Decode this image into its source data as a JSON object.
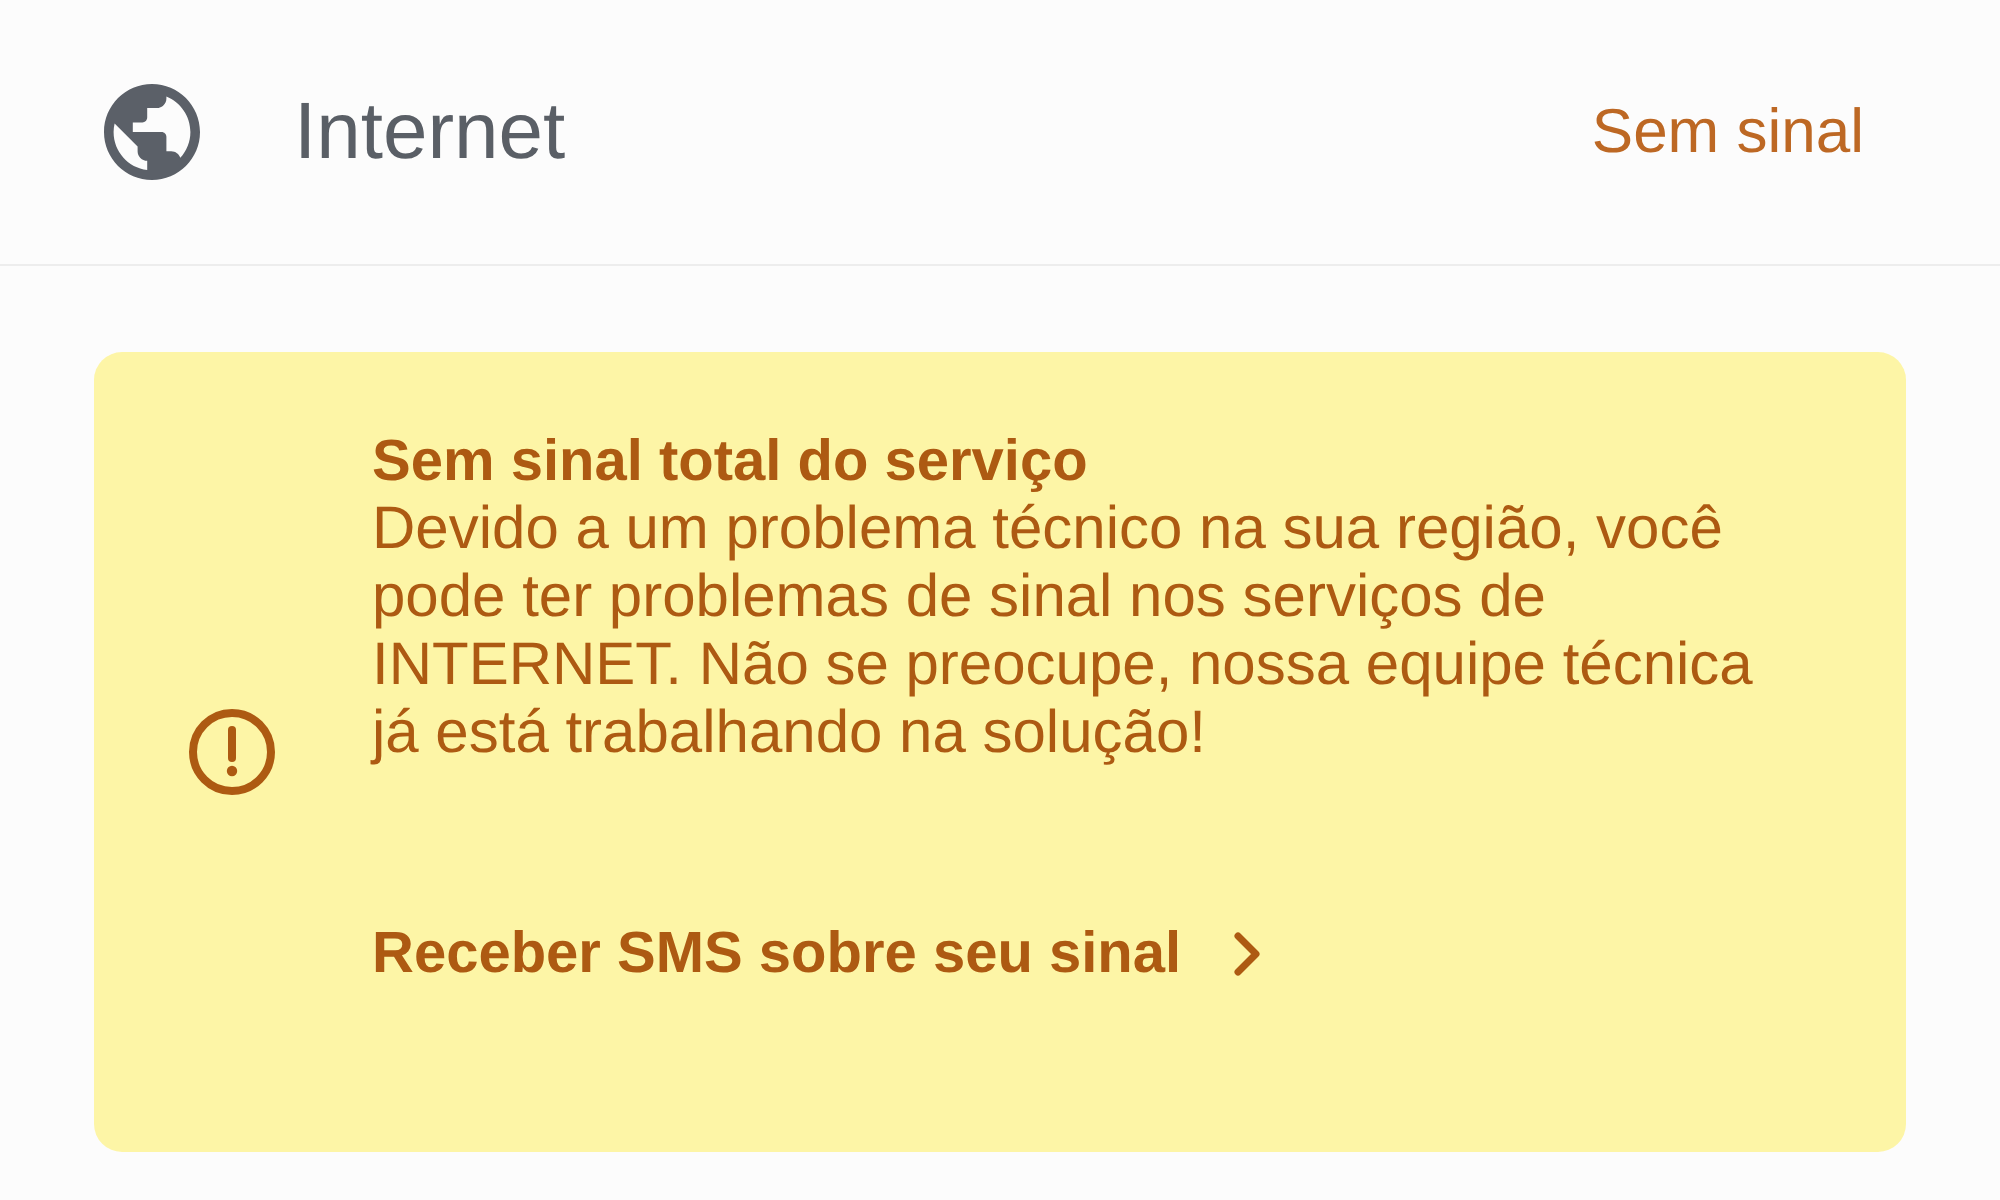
{
  "service_row": {
    "label": "Internet",
    "status": "Sem sinal"
  },
  "alert": {
    "title": "Sem sinal total do serviço",
    "message": "Devido a um problema técnico na sua região, você pode ter problemas de sinal nos serviços de INTERNET. Não se preocupe, nossa equipe técnica já está trabalhando na solução!",
    "action": {
      "label": "Receber SMS sobre seu sinal"
    }
  }
}
